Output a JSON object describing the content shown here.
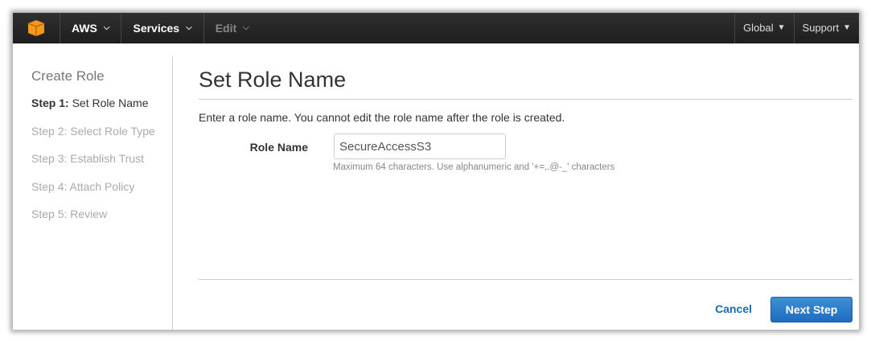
{
  "nav": {
    "aws": "AWS",
    "services": "Services",
    "edit": "Edit",
    "global": "Global",
    "support": "Support",
    "logo_color": "#f7981d"
  },
  "sidebar": {
    "title": "Create Role",
    "steps": [
      {
        "prefix": "Step 1:",
        "label": " Set Role Name",
        "active": true
      },
      {
        "label": "Step 2: Select Role Type"
      },
      {
        "label": "Step 3: Establish Trust"
      },
      {
        "label": "Step 4: Attach Policy"
      },
      {
        "label": "Step 5: Review"
      }
    ]
  },
  "main": {
    "title": "Set Role Name",
    "intro": "Enter a role name. You cannot edit the role name after the role is created.",
    "role_name_label": "Role Name",
    "role_name_value": "SecureAccessS3",
    "hint": "Maximum 64 characters. Use alphanumeric and '+=,.@-_' characters",
    "cancel": "Cancel",
    "next": "Next Step"
  }
}
